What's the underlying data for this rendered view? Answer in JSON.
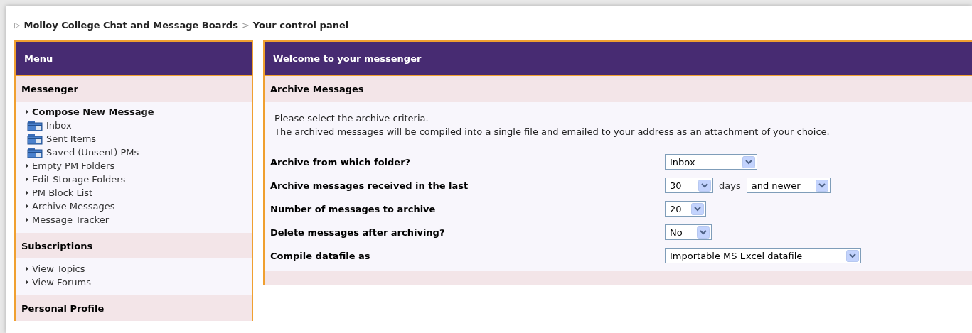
{
  "breadcrumb": {
    "marker": "▷",
    "items": [
      "Molloy College Chat and Message Boards",
      "Your control panel"
    ],
    "separator": ">"
  },
  "menu": {
    "title": "Menu",
    "sections": [
      {
        "title": "Messenger",
        "items": [
          {
            "kind": "primary",
            "label": "Compose New Message"
          },
          {
            "kind": "folder",
            "label": "Inbox"
          },
          {
            "kind": "folder",
            "label": "Sent Items"
          },
          {
            "kind": "folder",
            "label": "Saved (Unsent) PMs"
          },
          {
            "kind": "link",
            "label": "Empty PM Folders"
          },
          {
            "kind": "link",
            "label": "Edit Storage Folders"
          },
          {
            "kind": "link",
            "label": "PM Block List"
          },
          {
            "kind": "link",
            "label": "Archive Messages"
          },
          {
            "kind": "link",
            "label": "Message Tracker"
          }
        ]
      },
      {
        "title": "Subscriptions",
        "items": [
          {
            "kind": "link",
            "label": "View Topics"
          },
          {
            "kind": "link",
            "label": "View Forums"
          }
        ]
      },
      {
        "title": "Personal Profile"
      }
    ]
  },
  "main": {
    "title": "Welcome to your messenger",
    "section": "Archive Messages",
    "intro": [
      "Please select the archive criteria.",
      "The archived messages will be compiled into a single file and emailed to your address as an attachment of your choice."
    ],
    "fields": [
      {
        "label": "Archive from which folder?",
        "controls": [
          {
            "kind": "select",
            "value": "Inbox"
          }
        ]
      },
      {
        "label": "Archive messages received in the last",
        "controls": [
          {
            "kind": "select",
            "value": "30"
          },
          {
            "kind": "text",
            "text": "days"
          },
          {
            "kind": "select",
            "value": "and newer"
          }
        ]
      },
      {
        "label": "Number of messages to archive",
        "controls": [
          {
            "kind": "select",
            "value": "20"
          }
        ]
      },
      {
        "label": "Delete messages after archiving?",
        "controls": [
          {
            "kind": "select",
            "value": "No"
          }
        ]
      },
      {
        "label": "Compile datafile as",
        "controls": [
          {
            "kind": "select",
            "value": "Importable MS Excel datafile"
          }
        ]
      }
    ]
  }
}
